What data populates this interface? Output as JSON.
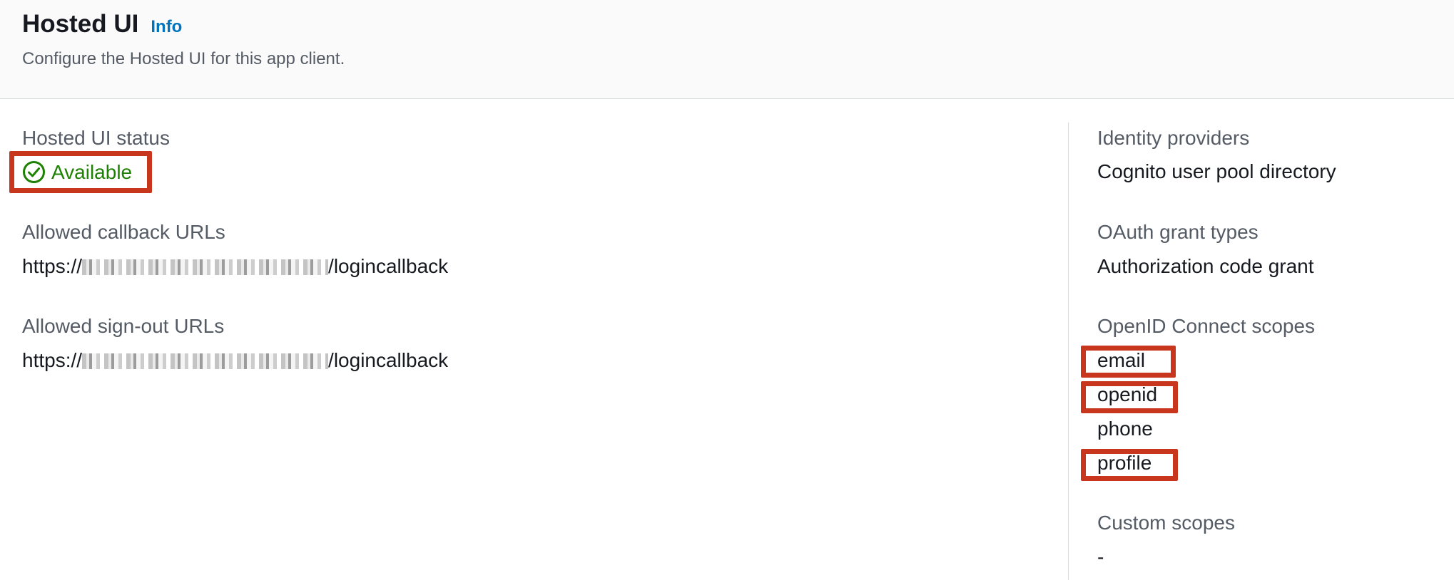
{
  "header": {
    "title": "Hosted UI",
    "info_link": "Info",
    "subtitle": "Configure the Hosted UI for this app client."
  },
  "left": {
    "status_label": "Hosted UI status",
    "status_value": "Available",
    "callback_label": "Allowed callback URLs",
    "callback_prefix": "https://",
    "callback_suffix": "/logincallback",
    "signout_label": "Allowed sign-out URLs",
    "signout_prefix": "https://",
    "signout_suffix": "/logincallback"
  },
  "right": {
    "idp_label": "Identity providers",
    "idp_value": "Cognito user pool directory",
    "grant_label": "OAuth grant types",
    "grant_value": "Authorization code grant",
    "scopes_label": "OpenID Connect scopes",
    "scopes": [
      "email",
      "openid",
      "phone",
      "profile"
    ],
    "custom_scopes_label": "Custom scopes",
    "custom_scopes_value": "-"
  },
  "icons": {
    "status": "check-circle-icon"
  },
  "colors": {
    "status_green": "#1d8102",
    "info_blue": "#0073bb",
    "highlight_red": "#c7361d"
  }
}
